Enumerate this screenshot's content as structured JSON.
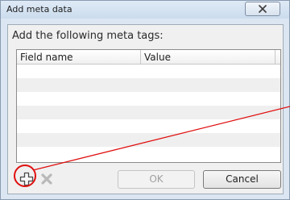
{
  "dialog": {
    "title": "Add meta data",
    "prompt": "Add the following meta tags:"
  },
  "table": {
    "columns": [
      "Field name",
      "Value"
    ],
    "rows": [
      [
        "",
        ""
      ],
      [
        "",
        ""
      ],
      [
        "",
        ""
      ],
      [
        "",
        ""
      ],
      [
        "",
        ""
      ],
      [
        "",
        ""
      ],
      [
        "",
        ""
      ]
    ]
  },
  "toolbar": {
    "add_icon": "plus-icon",
    "remove_icon": "remove-icon"
  },
  "buttons": {
    "ok_label": "OK",
    "ok_enabled": false,
    "cancel_label": "Cancel"
  },
  "annotation": {
    "color": "#e01010"
  }
}
